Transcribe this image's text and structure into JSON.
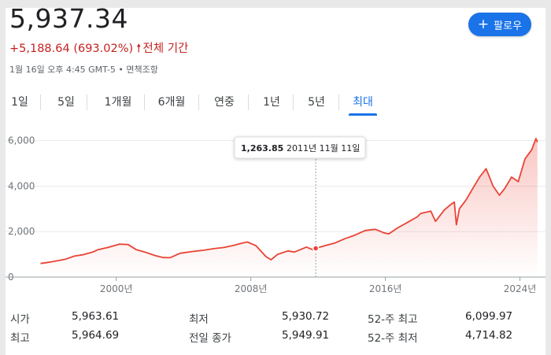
{
  "header": {
    "price": "5,937.34",
    "change": "+5,188.64 (693.02%)",
    "period": "전체 기간",
    "timestamp": "1월 16일 오후 4:45 GMT-5 • 면책조항"
  },
  "follow_button": {
    "label": "팔로우"
  },
  "tabs": [
    {
      "label": "1일"
    },
    {
      "label": "5일"
    },
    {
      "label": "1개월"
    },
    {
      "label": "6개월"
    },
    {
      "label": "연중"
    },
    {
      "label": "1년"
    },
    {
      "label": "5년"
    },
    {
      "label": "최대",
      "active": true
    }
  ],
  "tooltip": {
    "value": "1,263.85",
    "date": "2011년 11월 11일"
  },
  "chart_data": {
    "type": "area",
    "x_tick_labels": [
      "2000년",
      "2008년",
      "2016년",
      "2024년"
    ],
    "y_tick_labels": [
      "0",
      "2,000",
      "4,000",
      "6,000"
    ],
    "ylim": [
      0,
      6300
    ],
    "xlim": [
      1995.1,
      2025.05
    ],
    "line_color": "#ea4335",
    "series": [
      {
        "x": [
          1995.5,
          1996.0,
          1996.5,
          1997.0,
          1997.5,
          1998.0,
          1998.6,
          1998.9,
          1999.5,
          2000.2,
          2000.7,
          2001.2,
          2001.7,
          2002.3,
          2002.8,
          2003.2,
          2003.8,
          2004.5,
          2005.2,
          2005.8,
          2006.4,
          2007.0,
          2007.5,
          2007.8,
          2008.3,
          2008.9,
          2009.2,
          2009.6,
          2010.2,
          2010.6,
          2011.3,
          2011.7,
          2011.86,
          2012.4,
          2013.0,
          2013.6,
          2014.2,
          2014.8,
          2015.4,
          2015.9,
          2016.2,
          2016.7,
          2017.3,
          2017.9,
          2018.1,
          2018.7,
          2018.98,
          2019.5,
          2019.9,
          2020.1,
          2020.22,
          2020.4,
          2020.8,
          2021.2,
          2021.6,
          2021.99,
          2022.4,
          2022.78,
          2023.1,
          2023.5,
          2023.9,
          2024.3,
          2024.7,
          2024.95,
          2025.04
        ],
        "y": [
          600,
          650,
          720,
          790,
          920,
          980,
          1100,
          1200,
          1300,
          1450,
          1430,
          1200,
          1100,
          950,
          860,
          850,
          1050,
          1120,
          1180,
          1250,
          1300,
          1400,
          1500,
          1540,
          1380,
          900,
          760,
          1000,
          1150,
          1100,
          1320,
          1200,
          1263.85,
          1380,
          1500,
          1690,
          1850,
          2050,
          2100,
          1950,
          1900,
          2150,
          2400,
          2650,
          2800,
          2900,
          2450,
          2950,
          3200,
          3300,
          2300,
          3000,
          3400,
          3900,
          4400,
          4766,
          4000,
          3600,
          3900,
          4400,
          4200,
          5200,
          5600,
          6090,
          5937
        ]
      }
    ]
  },
  "stats": {
    "open_label": "시가",
    "open_value": "5,963.61",
    "high_label": "최고",
    "high_value": "5,964.69",
    "low_label": "최저",
    "low_value": "5,930.72",
    "prev_close_label": "전일 종가",
    "prev_close_value": "5,949.91",
    "w52_high_label": "52-주 최고",
    "w52_high_value": "6,099.97",
    "w52_low_label": "52-주 최저",
    "w52_low_value": "4,714.82"
  }
}
